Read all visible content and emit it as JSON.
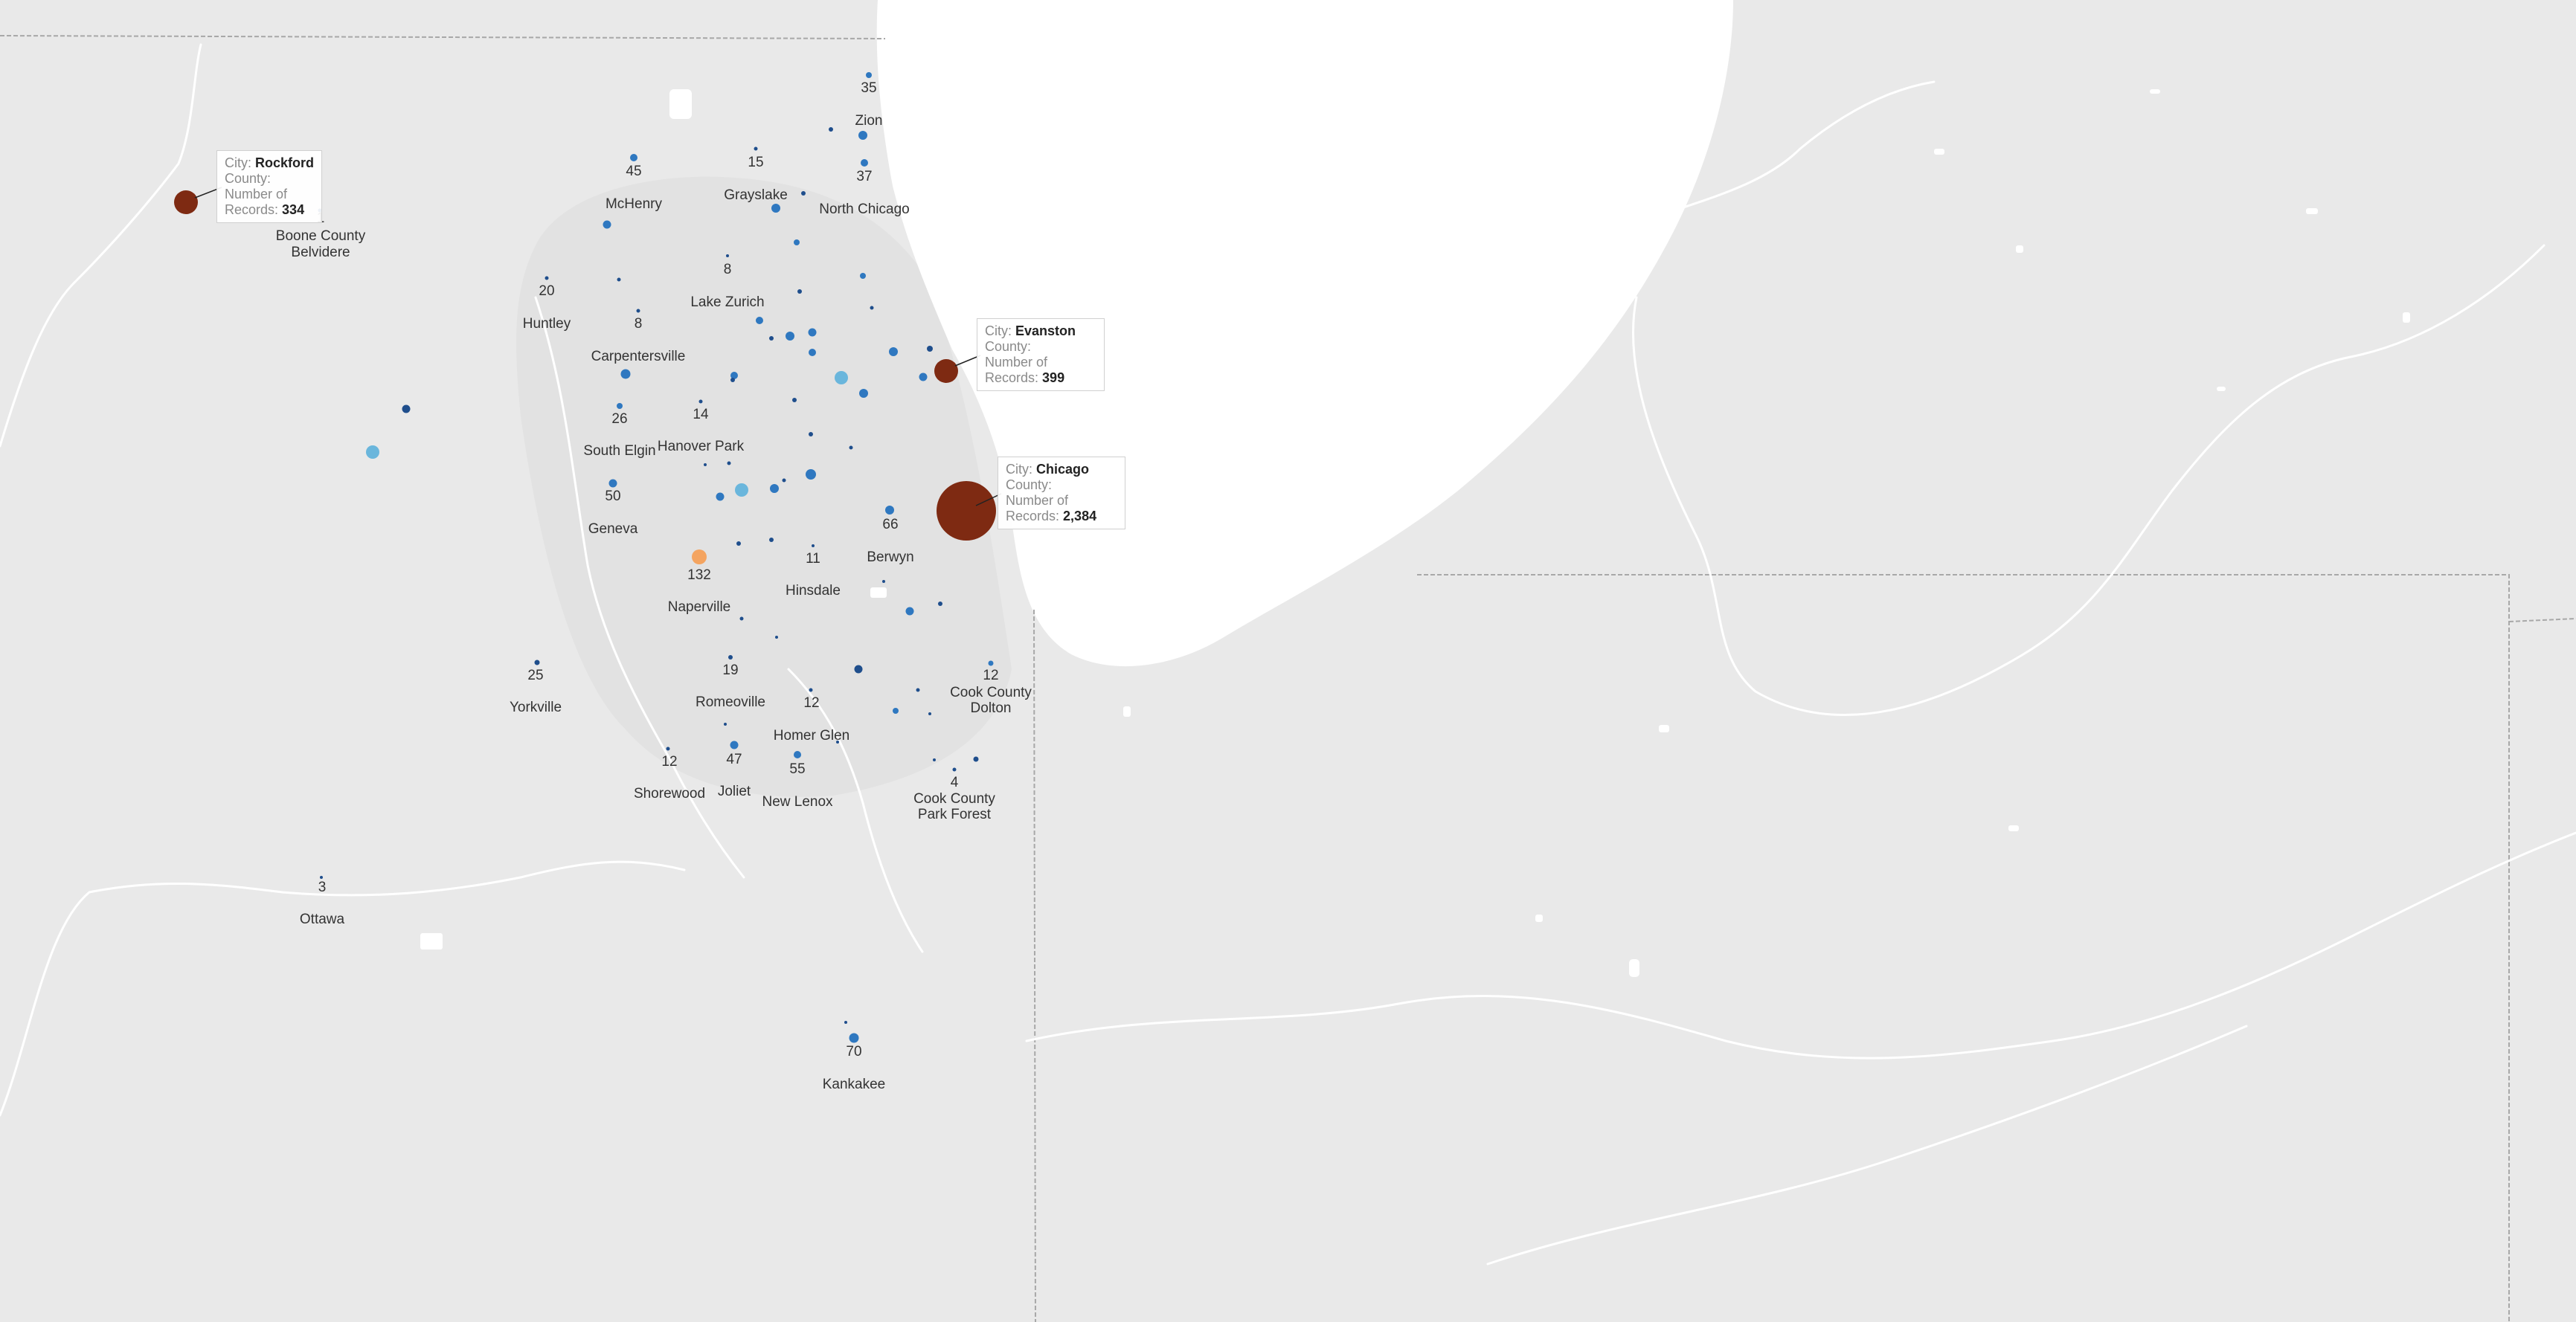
{
  "colors": {
    "land": "#e9e9e9",
    "water": "#ffffff",
    "border": "#a8a8a8",
    "river": "#ffffff",
    "dark_blue": "#1f4e8c",
    "mid_blue": "#2f78c0",
    "light_blue": "#6ab6dc",
    "orange": "#f4a460",
    "brown": "#7e2a12"
  },
  "labels": [
    {
      "id": "zion",
      "num": "35",
      "name": "Zion"
    },
    {
      "id": "mchenry",
      "num": "45",
      "name": "McHenry"
    },
    {
      "id": "grayslake",
      "num": "15",
      "name": "Grayslake"
    },
    {
      "id": "north-chicago",
      "num": "37",
      "name": "North Chicago"
    },
    {
      "id": "boone",
      "num": "1",
      "name": "Boone County",
      "name2": "Belvidere"
    },
    {
      "id": "huntley",
      "num": "20",
      "name": "Huntley"
    },
    {
      "id": "carpentersville",
      "num": "8",
      "name": "Carpentersville"
    },
    {
      "id": "lake-zurich",
      "num": "8",
      "name": "Lake Zurich"
    },
    {
      "id": "south-elgin",
      "num": "26",
      "name": "South Elgin"
    },
    {
      "id": "hanover-park",
      "num": "14",
      "name": "Hanover Park"
    },
    {
      "id": "geneva",
      "num": "50",
      "name": "Geneva"
    },
    {
      "id": "naperville",
      "num": "132",
      "name": "Naperville"
    },
    {
      "id": "hinsdale",
      "num": "11",
      "name": "Hinsdale"
    },
    {
      "id": "berwyn",
      "num": "66",
      "name": "Berwyn"
    },
    {
      "id": "yorkville",
      "num": "25",
      "name": "Yorkville"
    },
    {
      "id": "romeoville",
      "num": "19",
      "name": "Romeoville"
    },
    {
      "id": "homer-glen",
      "num": "12",
      "name": "Homer Glen"
    },
    {
      "id": "dolton",
      "num": "12",
      "name": "Cook County",
      "name2": "Dolton"
    },
    {
      "id": "shorewood",
      "num": "12",
      "name": "Shorewood"
    },
    {
      "id": "joliet",
      "num": "47",
      "name": "Joliet"
    },
    {
      "id": "new-lenox",
      "num": "55",
      "name": "New Lenox"
    },
    {
      "id": "park-forest",
      "num": "4",
      "name": "Cook County",
      "name2": "Park Forest"
    },
    {
      "id": "ottawa",
      "num": "3",
      "name": "Ottawa"
    },
    {
      "id": "kankakee",
      "num": "70",
      "name": "Kankakee"
    }
  ],
  "tooltips": {
    "rockford": {
      "city_key": "City:",
      "city": "Rockford",
      "county_key": "County:",
      "records_key1": "Number of",
      "records_key2": "Records:",
      "records": "334"
    },
    "evanston": {
      "city_key": "City:",
      "city": "Evanston",
      "county_key": "County:",
      "records_key1": "Number of",
      "records_key2": "Records:",
      "records": "399"
    },
    "chicago": {
      "city_key": "City:",
      "city": "Chicago",
      "county_key": "County:",
      "records_key1": "Number of",
      "records_key2": "Records:",
      "records": "2,384"
    }
  },
  "points": [
    {
      "name": "Chicago",
      "records": 2384,
      "c": "brown"
    },
    {
      "name": "Evanston",
      "records": 399,
      "c": "brown"
    },
    {
      "name": "Rockford",
      "records": 334,
      "c": "brown"
    },
    {
      "name": "Naperville",
      "records": 132,
      "c": "orange"
    },
    {
      "name": "Kankakee",
      "records": 70,
      "c": "mid_blue"
    },
    {
      "name": "Berwyn",
      "records": 66,
      "c": "mid_blue"
    },
    {
      "name": "New Lenox",
      "records": 55,
      "c": "mid_blue"
    },
    {
      "name": "Geneva",
      "records": 50,
      "c": "mid_blue"
    },
    {
      "name": "Joliet",
      "records": 47,
      "c": "mid_blue"
    },
    {
      "name": "McHenry",
      "records": 45,
      "c": "mid_blue"
    },
    {
      "name": "North Chicago",
      "records": 37,
      "c": "mid_blue"
    },
    {
      "name": "Zion",
      "records": 35,
      "c": "mid_blue"
    },
    {
      "name": "South Elgin",
      "records": 26,
      "c": "mid_blue"
    },
    {
      "name": "Yorkville",
      "records": 25,
      "c": "dark_blue"
    },
    {
      "name": "Huntley",
      "records": 20,
      "c": "dark_blue"
    },
    {
      "name": "Romeoville",
      "records": 19,
      "c": "dark_blue"
    },
    {
      "name": "Grayslake",
      "records": 15,
      "c": "dark_blue"
    },
    {
      "name": "Hanover Park",
      "records": 14,
      "c": "dark_blue"
    },
    {
      "name": "Homer Glen",
      "records": 12,
      "c": "dark_blue"
    },
    {
      "name": "Dolton",
      "records": 12,
      "c": "dark_blue"
    },
    {
      "name": "Shorewood",
      "records": 12,
      "c": "dark_blue"
    },
    {
      "name": "Hinsdale",
      "records": 11,
      "c": "dark_blue"
    },
    {
      "name": "Carpentersville",
      "records": 8,
      "c": "dark_blue"
    },
    {
      "name": "Lake Zurich",
      "records": 8,
      "c": "dark_blue"
    },
    {
      "name": "Park Forest",
      "records": 4,
      "c": "dark_blue"
    },
    {
      "name": "Ottawa",
      "records": 3,
      "c": "dark_blue"
    },
    {
      "name": "Belvidere",
      "records": 1,
      "c": "dark_blue"
    }
  ]
}
